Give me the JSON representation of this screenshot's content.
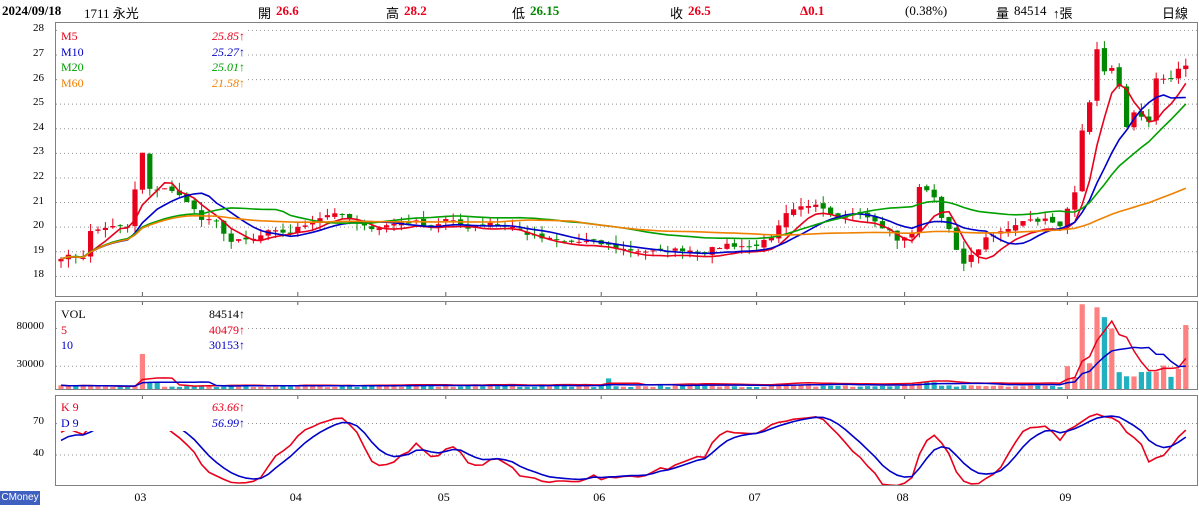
{
  "header": {
    "date": "2024/09/18",
    "stock": "1711 永光",
    "open_label": "開",
    "open": "26.6",
    "high_label": "高",
    "high": "28.2",
    "low_label": "低",
    "low": "26.15",
    "close_label": "收",
    "close": "26.5",
    "change": "Δ0.1",
    "change_pct": "(0.38%)",
    "volume_label": "量",
    "volume": "84514",
    "volume_unit": "↑張",
    "period": "日線"
  },
  "colors": {
    "up": "#e8001c",
    "down": "#008800",
    "ma5": "#e8001c",
    "ma10": "#0000c8",
    "ma20": "#00a000",
    "ma60": "#f08000",
    "vol_up": "#ff8080",
    "vol_down": "#20b0c0"
  },
  "legend_price": [
    {
      "label": "M5",
      "value": "25.85↑"
    },
    {
      "label": "M10",
      "value": "25.27↑"
    },
    {
      "label": "M20",
      "value": "25.01↑"
    },
    {
      "label": "M60",
      "value": "21.58↑"
    }
  ],
  "legend_volume": [
    {
      "label": "VOL",
      "value": "84514↑"
    },
    {
      "label": "5",
      "value": "40479↑"
    },
    {
      "label": "10",
      "value": "30153↑"
    }
  ],
  "legend_kd": [
    {
      "label": "K 9",
      "value": "63.66↑"
    },
    {
      "label": "D 9",
      "value": "56.99↑"
    }
  ],
  "brand": "CMoney",
  "chart_data": [
    {
      "type": "candlestick",
      "panel": "price",
      "ylim": [
        17.2,
        28.3
      ],
      "yticks": [
        "28",
        "27",
        "26",
        "25",
        "24",
        "23",
        "22",
        "21",
        "20",
        "19",
        "18"
      ],
      "x_months": [
        "03",
        "04",
        "05",
        "06",
        "07",
        "08",
        "09"
      ],
      "month_start_index": [
        11,
        32,
        52,
        73,
        94,
        114,
        136
      ],
      "series_close_keyframes": [
        [
          0,
          18.8
        ],
        [
          3,
          18.8
        ],
        [
          4,
          19.8
        ],
        [
          6,
          20.0
        ],
        [
          9,
          20.0
        ],
        [
          10,
          21.5
        ],
        [
          11,
          23.0
        ],
        [
          12,
          21.5
        ],
        [
          14,
          21.6
        ],
        [
          17,
          21.1
        ],
        [
          19,
          20.3
        ],
        [
          21,
          20.2
        ],
        [
          23,
          19.4
        ],
        [
          26,
          19.5
        ],
        [
          28,
          19.8
        ],
        [
          31,
          19.8
        ],
        [
          33,
          20.1
        ],
        [
          35,
          20.4
        ],
        [
          37,
          20.6
        ],
        [
          39,
          20.3
        ],
        [
          41,
          20.0
        ],
        [
          43,
          20.0
        ],
        [
          46,
          20.2
        ],
        [
          48,
          20.2
        ],
        [
          50,
          20.0
        ],
        [
          52,
          20.3
        ],
        [
          55,
          20.0
        ],
        [
          58,
          20.2
        ],
        [
          61,
          20.0
        ],
        [
          64,
          19.6
        ],
        [
          68,
          19.4
        ],
        [
          72,
          19.4
        ],
        [
          76,
          19.1
        ],
        [
          80,
          19.0
        ],
        [
          84,
          19.1
        ],
        [
          87,
          19.0
        ],
        [
          90,
          19.3
        ],
        [
          93,
          19.2
        ],
        [
          96,
          19.5
        ],
        [
          97,
          20.0
        ],
        [
          98,
          20.5
        ],
        [
          100,
          20.8
        ],
        [
          102,
          21.0
        ],
        [
          104,
          20.6
        ],
        [
          106,
          20.4
        ],
        [
          107,
          20.6
        ],
        [
          109,
          20.4
        ],
        [
          111,
          20.0
        ],
        [
          112,
          19.8
        ],
        [
          113,
          19.5
        ],
        [
          115,
          19.7
        ],
        [
          116,
          21.7
        ],
        [
          118,
          21.3
        ],
        [
          119,
          20.3
        ],
        [
          120,
          19.9
        ],
        [
          121,
          19.0
        ],
        [
          122,
          18.6
        ],
        [
          123,
          18.8
        ],
        [
          125,
          19.5
        ],
        [
          127,
          19.8
        ],
        [
          130,
          20.3
        ],
        [
          133,
          20.3
        ],
        [
          135,
          20.0
        ],
        [
          137,
          21.5
        ],
        [
          138,
          24.0
        ],
        [
          139,
          25.0
        ],
        [
          140,
          27.3
        ],
        [
          141,
          26.3
        ],
        [
          142,
          26.4
        ],
        [
          143,
          25.8
        ],
        [
          144,
          24.0
        ],
        [
          145,
          24.6
        ],
        [
          147,
          24.2
        ],
        [
          148,
          26.0
        ],
        [
          150,
          26.1
        ],
        [
          151,
          26.4
        ],
        [
          152,
          26.5
        ]
      ],
      "ma_last": {
        "M5": 25.85,
        "M10": 25.27,
        "M20": 25.01,
        "M60": 21.58
      }
    },
    {
      "type": "bar",
      "panel": "volume",
      "ylim": [
        0,
        115000
      ],
      "yticks": [
        "80000",
        "30000"
      ],
      "notes": "Daily volume bars with 5 and 10 day moving averages",
      "last": {
        "VOL": 84514,
        "MA5": 40479,
        "MA10": 30153
      }
    },
    {
      "type": "line",
      "panel": "kd",
      "ylim": [
        0,
        100
      ],
      "yticks": [
        "70",
        "40"
      ],
      "series": [
        {
          "name": "K 9",
          "last": 63.66
        },
        {
          "name": "D 9",
          "last": 56.99
        }
      ]
    }
  ]
}
